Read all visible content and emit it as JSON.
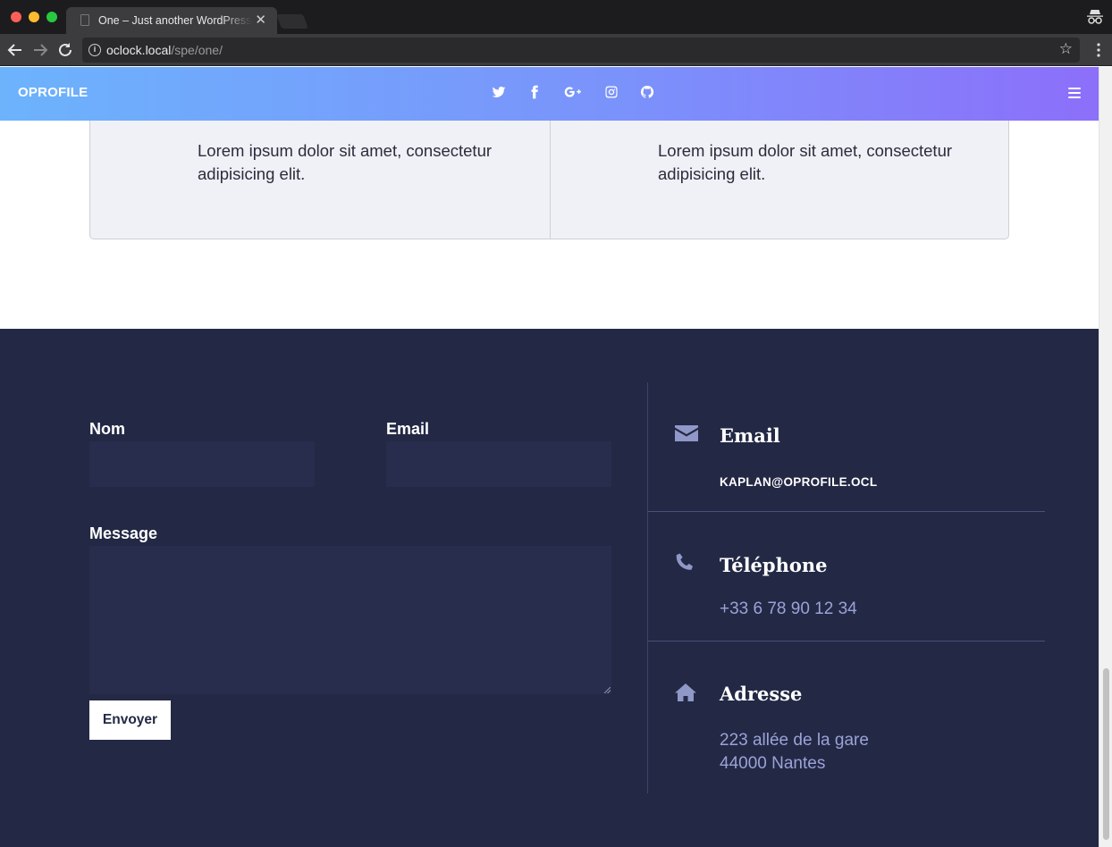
{
  "browser": {
    "tab_title": "One – Just another WordPress site",
    "tab_close": "✕",
    "url_host": "oclock.local",
    "url_path": "/spe/one/",
    "info_glyph": "i",
    "star_glyph": "☆"
  },
  "site": {
    "logo": "OPROFILE",
    "social_icons": [
      "twitter-icon",
      "facebook-icon",
      "google-plus-icon",
      "instagram-icon",
      "github-icon"
    ],
    "gradient": [
      "#6cb3fc",
      "#8c6ffa"
    ]
  },
  "cards": [
    {
      "text": "Lorem ipsum dolor sit amet, consectetur adipisicing elit."
    },
    {
      "text": "Lorem ipsum dolor sit amet, consectetur adipisicing elit."
    }
  ],
  "form": {
    "name_label": "Nom",
    "email_label": "Email",
    "message_label": "Message",
    "submit_label": "Envoyer"
  },
  "contact": {
    "email_title": "Email",
    "email_value": "KAPLAN@OPROFILE.OCL",
    "phone_title": "Téléphone",
    "phone_value": "+33 6 78 90 12 34",
    "address_title": "Adresse",
    "address_line1": "223 allée de la gare",
    "address_line2": "44000 Nantes"
  },
  "colors": {
    "footer_bg": "#232845",
    "input_bg": "#292d4d",
    "accent_text": "#9aa3d6"
  }
}
